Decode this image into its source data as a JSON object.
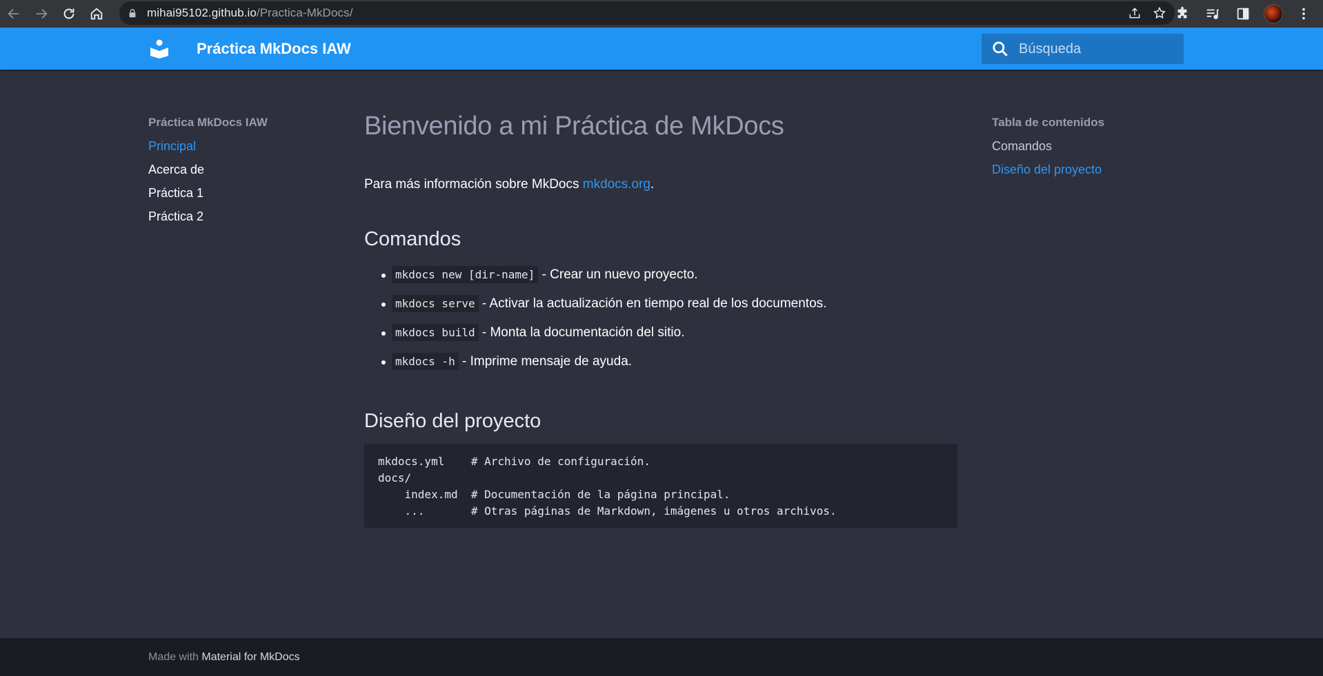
{
  "browser": {
    "url_host": "mihai95102.github.io",
    "url_path": "/Practica-MkDocs/",
    "icons": [
      "back-arrow-icon",
      "forward-arrow-icon",
      "reload-icon",
      "home-icon",
      "lock-icon",
      "share-icon",
      "star-icon",
      "extensions-icon",
      "media-control-icon",
      "side-panel-icon",
      "kebab-menu-icon"
    ]
  },
  "header": {
    "title": "Práctica MkDocs IAW",
    "search_placeholder": "Búsqueda",
    "accent_color": "#2094f3"
  },
  "left_nav": {
    "title": "Práctica MkDocs IAW",
    "items": [
      {
        "label": "Principal",
        "active": true
      },
      {
        "label": "Acerca de",
        "active": false
      },
      {
        "label": "Práctica 1",
        "active": false
      },
      {
        "label": "Práctica 2",
        "active": false
      }
    ]
  },
  "toc": {
    "title": "Tabla de contenidos",
    "items": [
      {
        "label": "Comandos",
        "active": false
      },
      {
        "label": "Diseño del proyecto",
        "active": true
      }
    ]
  },
  "content": {
    "h1": "Bienvenido a mi Práctica de MkDocs",
    "intro_text": "Para más información sobre MkDocs ",
    "intro_link": "mkdocs.org",
    "intro_end": ".",
    "section_commands": "Comandos",
    "commands": [
      {
        "code": "mkdocs new [dir-name]",
        "desc": " - Crear un nuevo proyecto."
      },
      {
        "code": "mkdocs serve",
        "desc": " - Activar la actualización en tiempo real de los documentos."
      },
      {
        "code": "mkdocs build",
        "desc": " - Monta la documentación del sitio."
      },
      {
        "code": "mkdocs -h",
        "desc": " - Imprime mensaje de ayuda."
      }
    ],
    "section_layout": "Diseño del proyecto",
    "code_block": "mkdocs.yml    # Archivo de configuración.\ndocs/\n    index.md  # Documentación de la página principal.\n    ...       # Otras páginas de Markdown, imágenes u otros archivos."
  },
  "footer": {
    "prefix": "Made with ",
    "link": "Material for MkDocs"
  }
}
